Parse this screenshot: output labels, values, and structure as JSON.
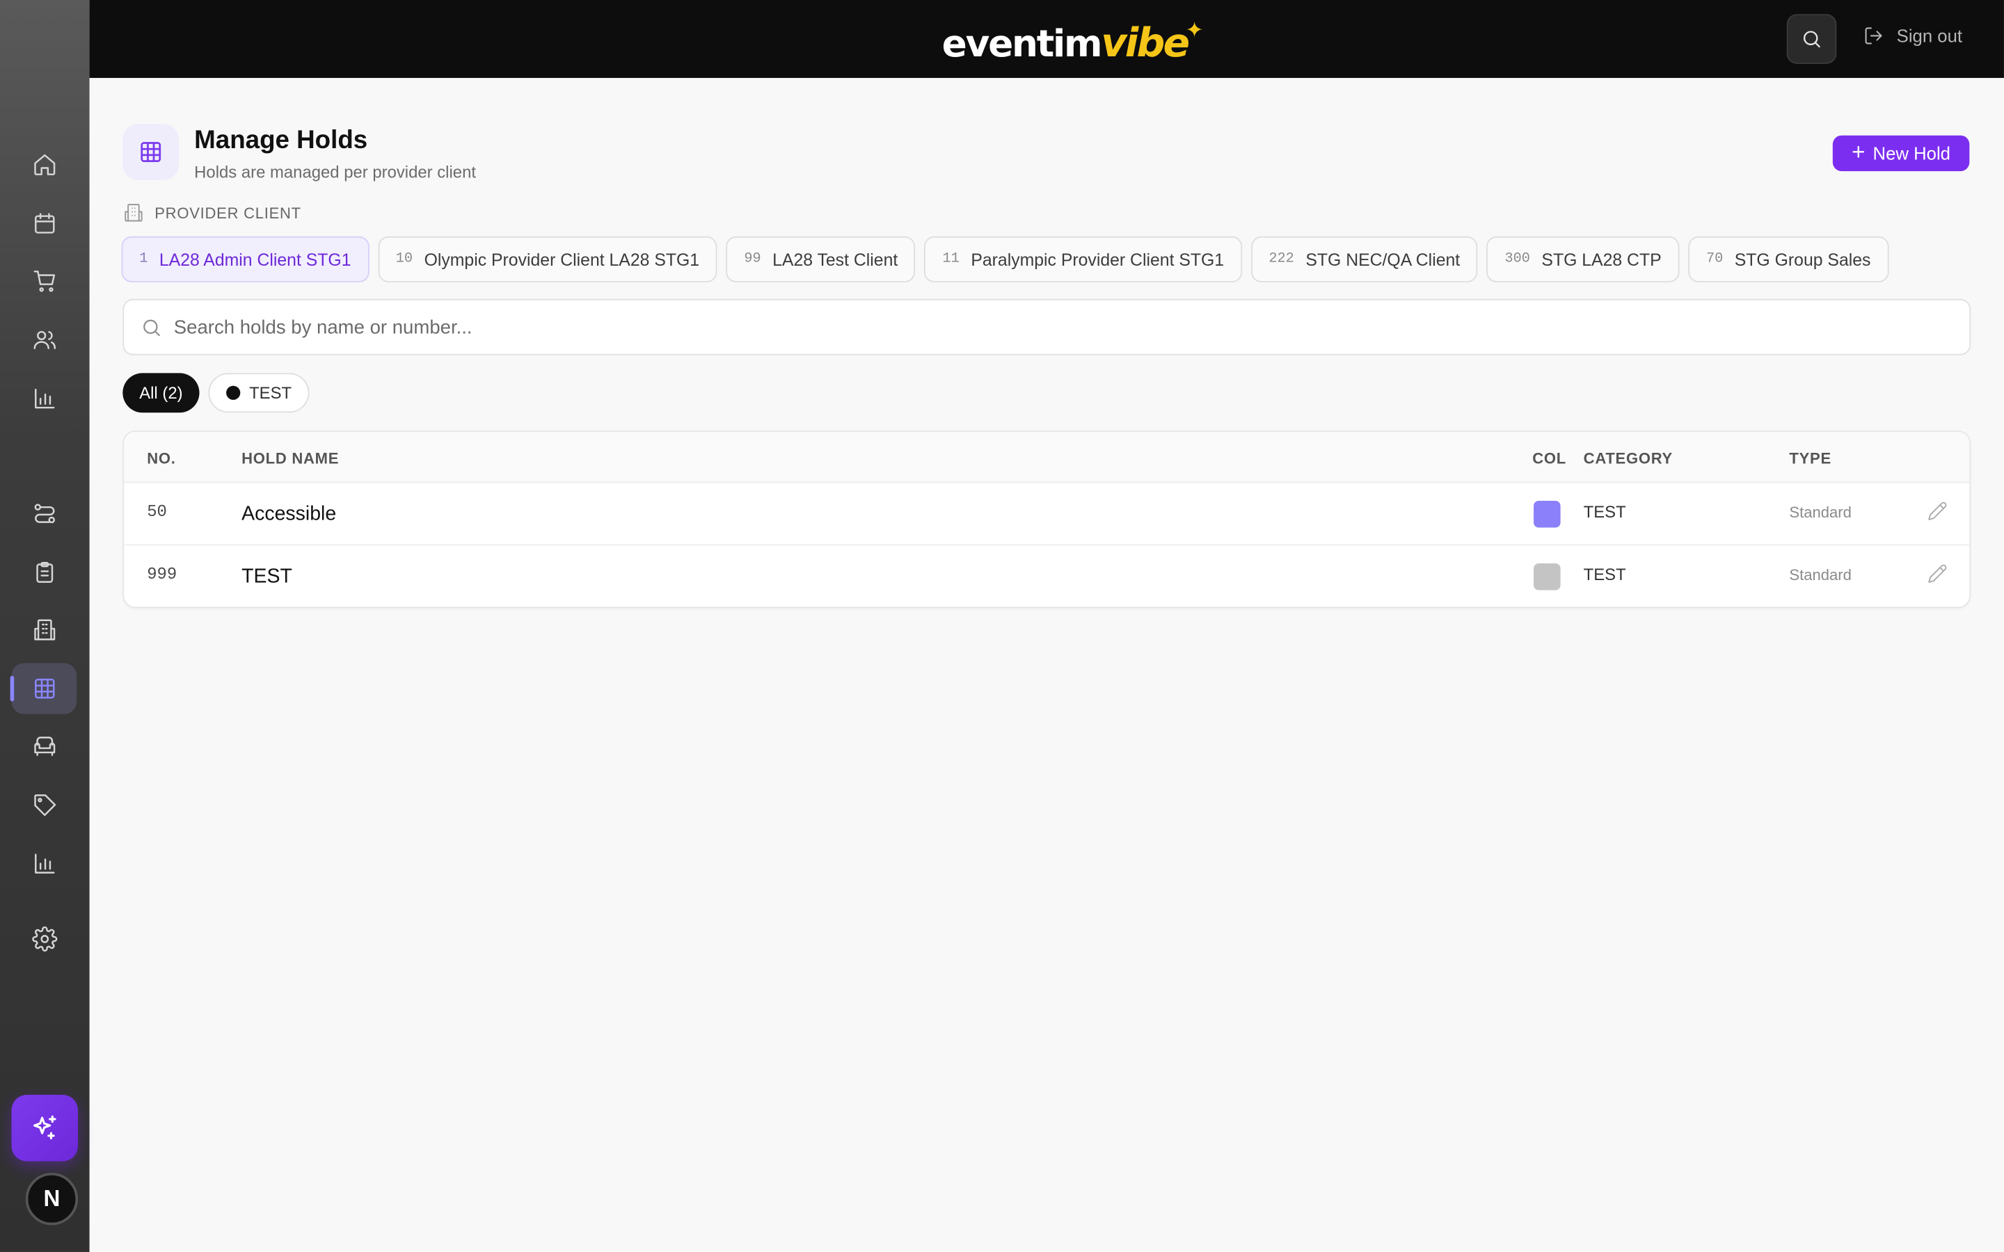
{
  "app": {
    "logo_main": "eventim",
    "logo_accent": "vibe",
    "logo_star": "✦"
  },
  "topbar": {
    "sign_out_label": "Sign out"
  },
  "sidebar": {
    "items": [
      {
        "icon": "home-icon"
      },
      {
        "icon": "calendar-icon"
      },
      {
        "icon": "cart-icon"
      },
      {
        "icon": "users-icon"
      },
      {
        "icon": "bar-chart-icon"
      },
      {
        "icon": "route-icon"
      },
      {
        "icon": "clipboard-icon"
      },
      {
        "icon": "building-icon"
      },
      {
        "icon": "grid-icon",
        "active": true
      },
      {
        "icon": "seat-icon"
      },
      {
        "icon": "tag-icon"
      },
      {
        "icon": "bar-chart-icon"
      },
      {
        "icon": "gear-icon"
      }
    ],
    "avatar_letter": "N"
  },
  "header": {
    "title": "Manage Holds",
    "subtitle": "Holds are managed per provider client",
    "new_hold_label": "New Hold"
  },
  "provider_client": {
    "label": "PROVIDER CLIENT",
    "chips": [
      {
        "num": "1",
        "label": "LA28 Admin Client STG1",
        "active": true
      },
      {
        "num": "10",
        "label": "Olympic Provider Client LA28 STG1"
      },
      {
        "num": "99",
        "label": "LA28 Test Client"
      },
      {
        "num": "11",
        "label": "Paralympic Provider Client STG1"
      },
      {
        "num": "222",
        "label": "STG NEC/QA Client"
      },
      {
        "num": "300",
        "label": "STG LA28 CTP"
      },
      {
        "num": "70",
        "label": "STG Group Sales"
      }
    ]
  },
  "search": {
    "placeholder": "Search holds by name or number..."
  },
  "filters": {
    "all_label": "All (2)",
    "test_label": "TEST"
  },
  "table": {
    "columns": {
      "no": "NO.",
      "name": "HOLD NAME",
      "col": "COL",
      "category": "CATEGORY",
      "type": "TYPE"
    },
    "rows": [
      {
        "no": "50",
        "name": "Accessible",
        "color": "#8b80f9",
        "category": "TEST",
        "type": "Standard"
      },
      {
        "no": "999",
        "name": "TEST",
        "color": "#c4c4c4",
        "category": "TEST",
        "type": "Standard"
      }
    ]
  },
  "colors": {
    "accent": "#7c2ef0",
    "sidebar_active": "#8b86ff"
  }
}
